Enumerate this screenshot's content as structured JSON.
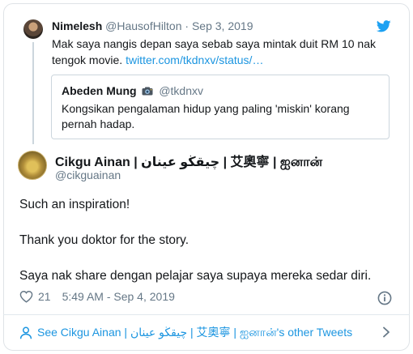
{
  "parent_tweet": {
    "name": "Nimelesh",
    "handle": "@HausofHilton",
    "date": "Sep 3, 2019",
    "text": "Mak saya nangis depan saya sebab saya mintak duit RM 10 nak tengok movie.",
    "link": "twitter.com/tkdnxv/status/…"
  },
  "quoted_tweet": {
    "name": "Abeden Mung",
    "handle": "@tkdnxv",
    "text": "Kongsikan pengalaman hidup yang paling 'miskin' korang pernah hadap."
  },
  "main_tweet": {
    "name": "Cikgu Ainan | چيقڬو عينان | 艾奧寧 | ஐனான்",
    "handle": "@cikguainan",
    "lines": [
      "Such an inspiration!",
      "Thank you doktor for the story.",
      "Saya nak share dengan pelajar saya supaya mereka sedar diri."
    ],
    "likes": "21",
    "timestamp": "5:49 AM - Sep 4, 2019"
  },
  "footer": {
    "link_text": "See Cikgu Ainan | چيقڬو عينان | 艾奧寧 | ஐனான்'s other Tweets"
  },
  "colors": {
    "link": "#1b95e0",
    "muted": "#657786",
    "twitter_blue": "#1da1f2"
  },
  "icons": [
    "twitter-bird-icon",
    "camera-icon",
    "heart-icon",
    "info-icon",
    "user-icon",
    "chevron-right-icon"
  ]
}
